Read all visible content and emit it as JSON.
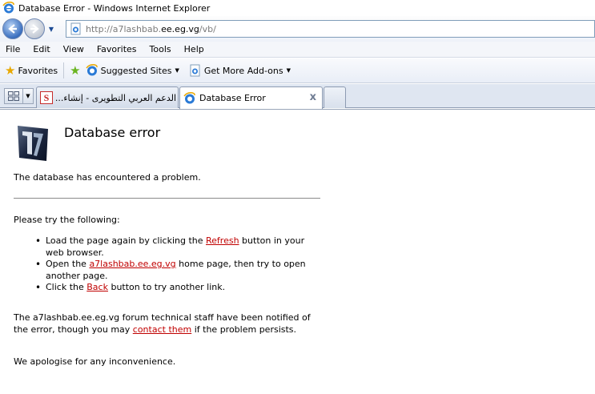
{
  "window": {
    "title": "Database Error - Windows Internet Explorer"
  },
  "address_bar": {
    "url_prefix": "http://a7lashbab.",
    "url_domain": "ee.eg.vg",
    "url_suffix": "/vb/"
  },
  "menu": {
    "items": [
      "File",
      "Edit",
      "View",
      "Favorites",
      "Tools",
      "Help"
    ]
  },
  "favorites_bar": {
    "favorites_label": "Favorites",
    "links": [
      "Suggested Sites",
      "Get More Add-ons"
    ]
  },
  "tabs": [
    {
      "label": "الدعم العربي التطويرى - إنشاء...",
      "active": false,
      "icon": "s-site-icon"
    },
    {
      "label": "Database Error",
      "active": true,
      "icon": "ie-page-icon"
    }
  ],
  "page": {
    "title": "Database error",
    "intro": "The database has encountered a problem.",
    "try_heading": "Please try the following:",
    "items": [
      {
        "before": "Load the page again by clicking the ",
        "link": "Refresh",
        "after": " button in your web browser."
      },
      {
        "before": "Open the ",
        "link": "a7lashbab.ee.eg.vg",
        "after": " home page, then try to open another page."
      },
      {
        "before": "Click the ",
        "link": "Back",
        "after": " button to try another link."
      }
    ],
    "staff_before": "The a7lashbab.ee.eg.vg forum technical staff have been notified of the error, though you may ",
    "staff_link": "contact them",
    "staff_after": " if the problem persists.",
    "apology": "We apologise for any inconvenience."
  },
  "colors": {
    "link": "#c00000",
    "chrome_blue": "#3a6fbf"
  }
}
